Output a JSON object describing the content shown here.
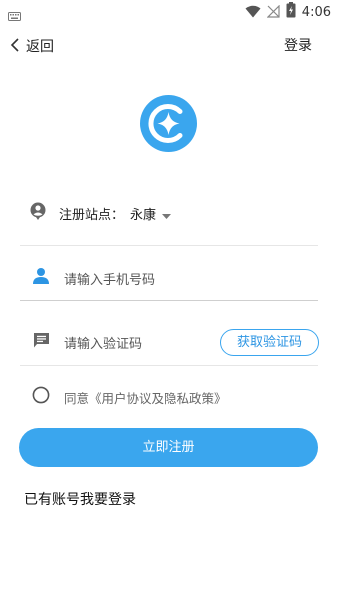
{
  "status_bar": {
    "time": "4:06",
    "icons": [
      "keyboard-icon",
      "wifi-icon",
      "no-signal-icon",
      "battery-charging-icon"
    ]
  },
  "header": {
    "back_label": "返回",
    "login_label": "登录"
  },
  "logo": {
    "icon": "app-logo-icon",
    "color": "#3aa6ee"
  },
  "form": {
    "station": {
      "label": "注册站点：",
      "value": "永康",
      "icon": "location-pin-icon"
    },
    "phone": {
      "placeholder": "请输入手机号码",
      "icon": "person-icon"
    },
    "code": {
      "placeholder": "请输入验证码",
      "icon": "message-icon",
      "get_code_label": "获取验证码"
    },
    "agreement": {
      "text": "同意《用户协议及隐私政策》"
    },
    "register_label": "立即注册",
    "have_account_label": "已有账号我要登录"
  },
  "colors": {
    "accent": "#3aa6ee",
    "text": "#222222",
    "muted": "#666666"
  }
}
